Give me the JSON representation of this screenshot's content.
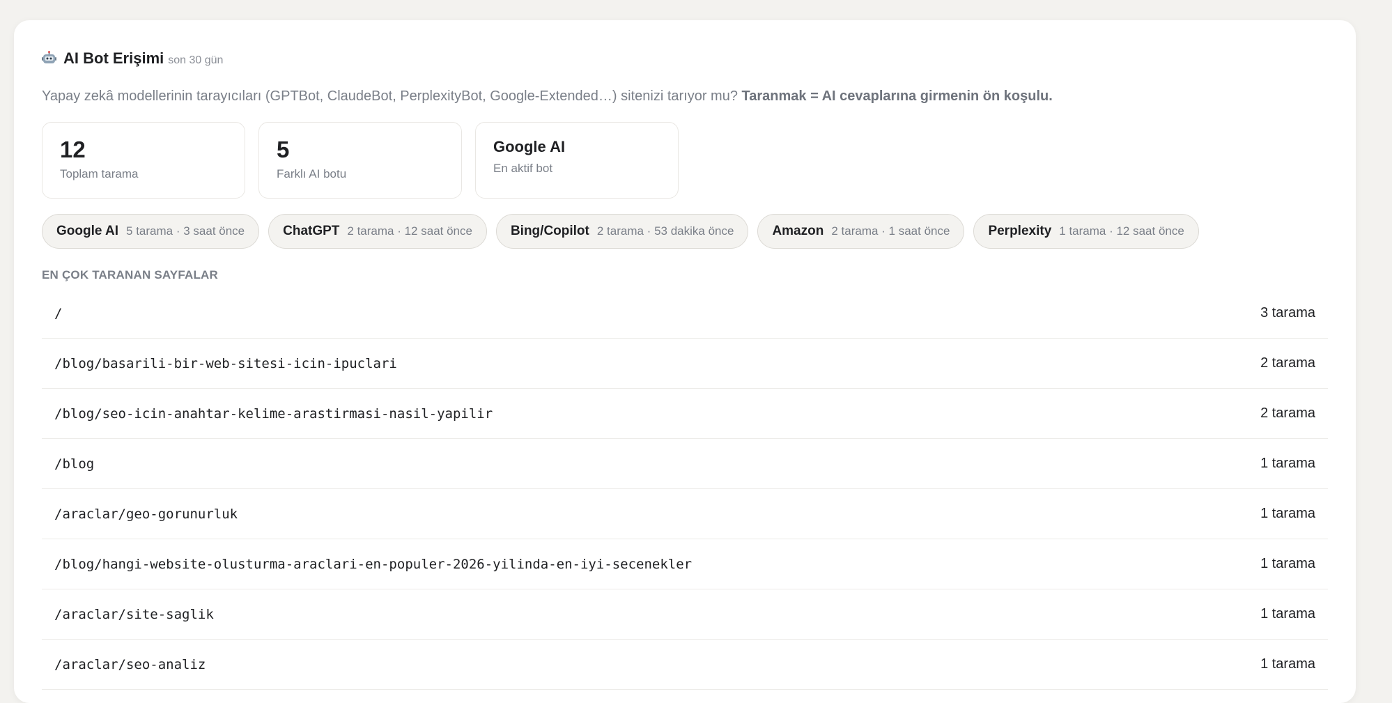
{
  "header": {
    "title": "AI Bot Erişimi",
    "subtitle": "son 30 gün",
    "icon": "robot-icon"
  },
  "description": {
    "text": "Yapay zekâ modellerinin tarayıcıları (GPTBot, ClaudeBot, PerplexityBot, Google-Extended…) sitenizi tarıyor mu? ",
    "bold": "Taranmak = AI cevaplarına girmenin ön koşulu."
  },
  "stats": [
    {
      "value": "12",
      "label": "Toplam tarama"
    },
    {
      "value": "5",
      "label": "Farklı AI botu"
    },
    {
      "value": "Google AI",
      "label": "En aktif bot"
    }
  ],
  "bots": [
    {
      "name": "Google AI",
      "meta": "5 tarama · 3 saat önce"
    },
    {
      "name": "ChatGPT",
      "meta": "2 tarama · 12 saat önce"
    },
    {
      "name": "Bing/Copilot",
      "meta": "2 tarama · 53 dakika önce"
    },
    {
      "name": "Amazon",
      "meta": "2 tarama · 1 saat önce"
    },
    {
      "name": "Perplexity",
      "meta": "1 tarama · 12 saat önce"
    }
  ],
  "pages_section": {
    "title": "EN ÇOK TARANAN SAYFALAR",
    "rows": [
      {
        "path": "/",
        "count": "3 tarama"
      },
      {
        "path": "/blog/basarili-bir-web-sitesi-icin-ipuclari",
        "count": "2 tarama"
      },
      {
        "path": "/blog/seo-icin-anahtar-kelime-arastirmasi-nasil-yapilir",
        "count": "2 tarama"
      },
      {
        "path": "/blog",
        "count": "1 tarama"
      },
      {
        "path": "/araclar/geo-gorunurluk",
        "count": "1 tarama"
      },
      {
        "path": "/blog/hangi-website-olusturma-araclari-en-populer-2026-yilinda-en-iyi-secenekler",
        "count": "1 tarama"
      },
      {
        "path": "/araclar/site-saglik",
        "count": "1 tarama"
      },
      {
        "path": "/araclar/seo-analiz",
        "count": "1 tarama"
      }
    ]
  }
}
